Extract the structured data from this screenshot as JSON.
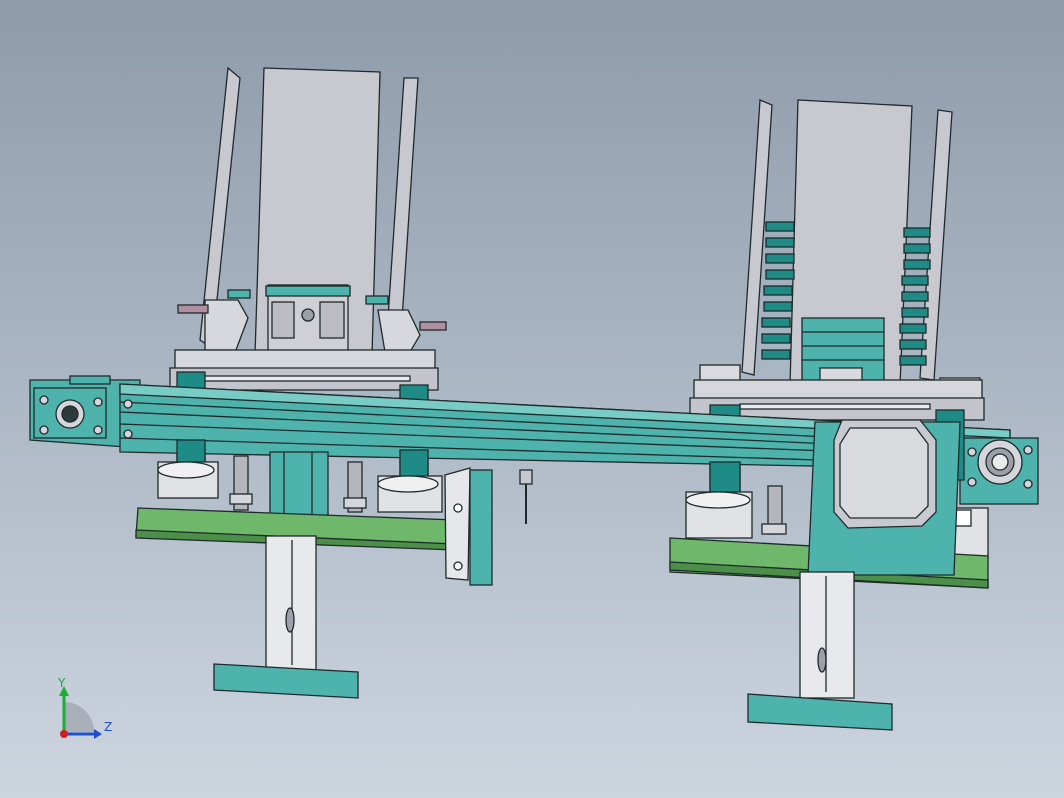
{
  "viewport": {
    "background_top": "#8e9bab",
    "background_bottom": "#cdd5df"
  },
  "colors": {
    "teal_part": "#4fb3ad",
    "teal_dark": "#1f8b86",
    "green_plate": "#6fb76b",
    "gray_part": "#c8c9d0",
    "edge": "#1e2a2a"
  },
  "triad": {
    "y_label": "Y",
    "z_label": "Z",
    "y_color": "#1faa3a",
    "z_color": "#1e4fd0",
    "x_color": "#d01e1e"
  }
}
